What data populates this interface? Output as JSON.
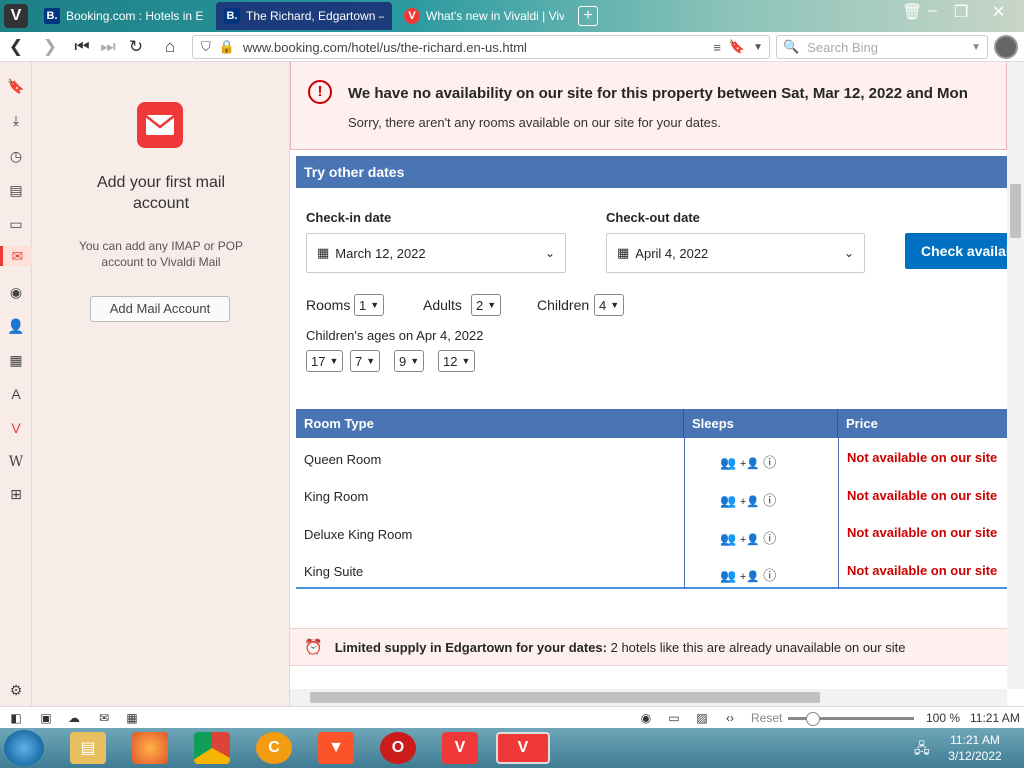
{
  "tabs": [
    {
      "label": "Booking.com : Hotels in Edgartown",
      "favicon": "B.",
      "active": false
    },
    {
      "label": "The Richard, Edgartown – U",
      "favicon": "B.",
      "active": true
    },
    {
      "label": "What's new in Vivaldi | Vivaldi",
      "favicon": "V",
      "active": false
    }
  ],
  "address": {
    "url": "www.booking.com/hotel/us/the-richard.en-us.html",
    "search_placeholder": "Search Bing"
  },
  "mail_panel": {
    "title": "Add your first mail account",
    "description": "You can add any IMAP or POP account to Vivaldi Mail",
    "button": "Add Mail Account"
  },
  "alert": {
    "title": "We have no availability on our site for this property between Sat, Mar 12, 2022 and Mon",
    "subtitle": "Sorry, there aren't any rooms available on our site for your dates."
  },
  "try_dates": {
    "heading": "Try other dates",
    "checkin_label": "Check-in date",
    "checkin_value": "March 12, 2022",
    "checkout_label": "Check-out date",
    "checkout_value": "April 4, 2022",
    "check_button": "Check availab"
  },
  "occupancy": {
    "rooms_label": "Rooms",
    "rooms_value": "1",
    "adults_label": "Adults",
    "adults_value": "2",
    "children_label": "Children",
    "children_value": "4",
    "ages_label": "Children's ages on Apr 4, 2022",
    "ages": [
      "17",
      "7",
      "9",
      "12"
    ]
  },
  "table": {
    "headers": {
      "room_type": "Room Type",
      "sleeps": "Sleeps",
      "price": "Price"
    },
    "rows": [
      {
        "room": "Queen Room",
        "price": "Not available on our site"
      },
      {
        "room": "King Room",
        "price": "Not available on our site"
      },
      {
        "room": "Deluxe King Room",
        "price": "Not available on our site"
      },
      {
        "room": "King Suite",
        "price": "Not available on our site"
      }
    ]
  },
  "limited": {
    "bold": "Limited supply in Edgartown for your dates:",
    "text": "2 hotels like this are already unavailable on our site"
  },
  "statusbar": {
    "reset": "Reset",
    "zoom": "100 %",
    "time": "11:21 AM"
  },
  "taskbar": {
    "time": "11:21 AM",
    "date": "3/12/2022"
  },
  "colors": {
    "accent_red": "#ef3939",
    "booking_blue": "#4a75b5",
    "button_blue": "#0071c2",
    "unavailable_red": "#cc0000"
  }
}
